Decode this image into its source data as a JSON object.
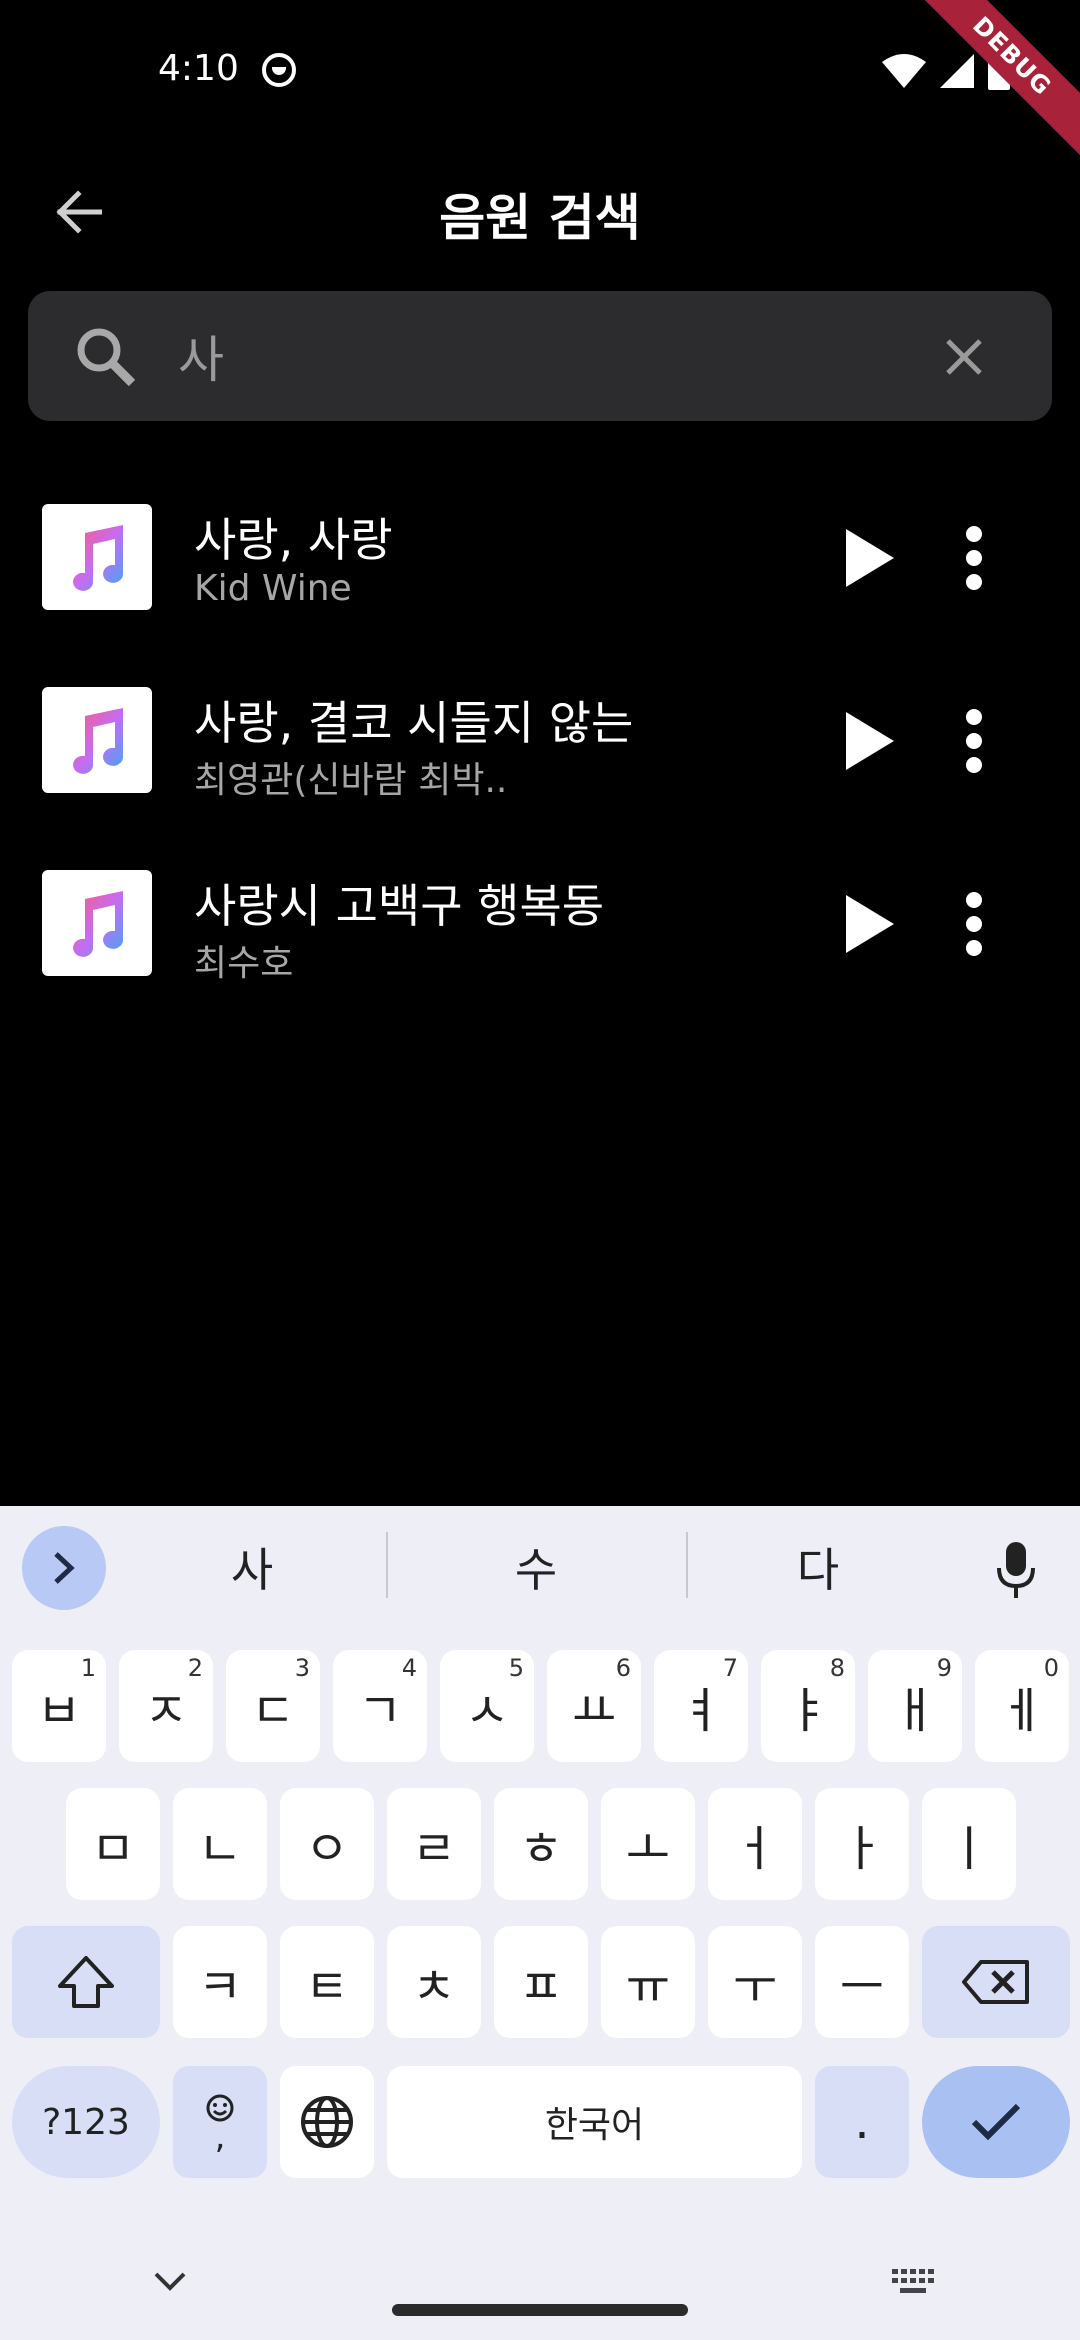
{
  "status_bar": {
    "time": "4:10",
    "debug_label": "DEBUG"
  },
  "app_bar": {
    "title": "음원 검색"
  },
  "search": {
    "value": "사",
    "placeholder": ""
  },
  "results": [
    {
      "title": "사랑, 사랑",
      "artist": "Kid Wine"
    },
    {
      "title": "사랑, 결코 시들지 않는",
      "artist": "최영관(신바람 최박.."
    },
    {
      "title": "사랑시 고백구 행복동",
      "artist": "최수호"
    }
  ],
  "keyboard": {
    "suggestions": [
      "사",
      "수",
      "다"
    ],
    "row1": [
      {
        "label": "ㅂ",
        "hint": "1"
      },
      {
        "label": "ㅈ",
        "hint": "2"
      },
      {
        "label": "ㄷ",
        "hint": "3"
      },
      {
        "label": "ㄱ",
        "hint": "4"
      },
      {
        "label": "ㅅ",
        "hint": "5"
      },
      {
        "label": "ㅛ",
        "hint": "6"
      },
      {
        "label": "ㅕ",
        "hint": "7"
      },
      {
        "label": "ㅑ",
        "hint": "8"
      },
      {
        "label": "ㅐ",
        "hint": "9"
      },
      {
        "label": "ㅔ",
        "hint": "0"
      }
    ],
    "row2": [
      "ㅁ",
      "ㄴ",
      "ㅇ",
      "ㄹ",
      "ㅎ",
      "ㅗ",
      "ㅓ",
      "ㅏ",
      "ㅣ"
    ],
    "row3": [
      "ㅋ",
      "ㅌ",
      "ㅊ",
      "ㅍ",
      "ㅠ",
      "ㅜ",
      "ㅡ"
    ],
    "symbols_label": "?123",
    "emoji_comma_label": ",",
    "space_label": "한국어",
    "period_label": "."
  }
}
